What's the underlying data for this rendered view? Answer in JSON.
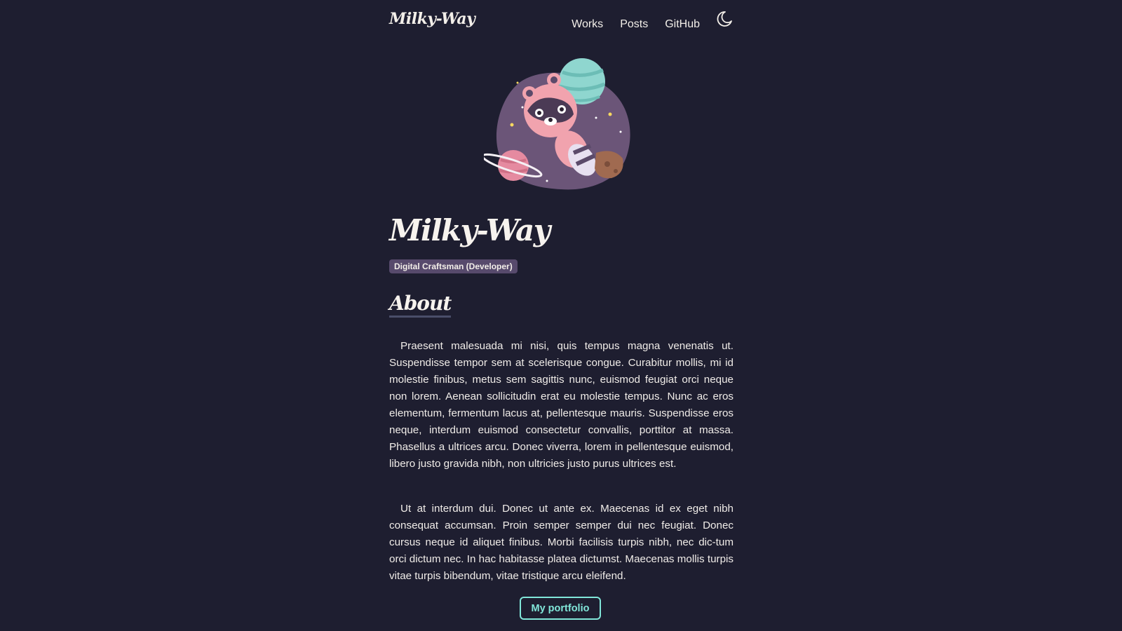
{
  "nav": {
    "logo": "Milky-Way",
    "links": [
      "Works",
      "Posts",
      "GitHub"
    ],
    "theme_icon": "moon-icon"
  },
  "hero": {
    "image": "astronaut-raccoon-illustration"
  },
  "profile": {
    "name": "Milky-Way",
    "role": "Digital Craftsman (Developer)"
  },
  "about": {
    "heading": "About",
    "paragraphs": [
      "Praesent malesuada mi nisi, quis tempus magna venenatis ut. Suspendisse tempor sem at scelerisque congue. Curabitur mollis, mi id molestie finibus, metus sem sagittis nunc, euismod feugiat orci neque non lorem. Aenean sollicitudin erat eu molestie tempus. Nunc ac eros elementum, fermentum lacus at, pellentesque mauris. Suspendisse eros neque, interdum euismod consectetur convallis, porttitor at massa. Phasellus a ultrices arcu. Donec viverra, lorem in pellentesque euismod, libero justo gravida nibh, non ultricies justo purus ultrices est.",
      "Ut at interdum dui. Donec ut ante ex. Maecenas id ex eget nibh consequat accumsan. Proin semper semper dui nec feugiat. Donec cursus neque id aliquet finibus. Morbi facilisis turpis nibh, nec dic-tum orci dictum nec. In hac habitasse platea dictumst. Maecenas mollis turpis vitae turpis bibendum, vitae tristique arcu eleifend."
    ],
    "button_label": "My portfolio"
  },
  "colors": {
    "background": "#1e1e30",
    "accent": "#81e6d9",
    "badge": "#574a6c"
  }
}
